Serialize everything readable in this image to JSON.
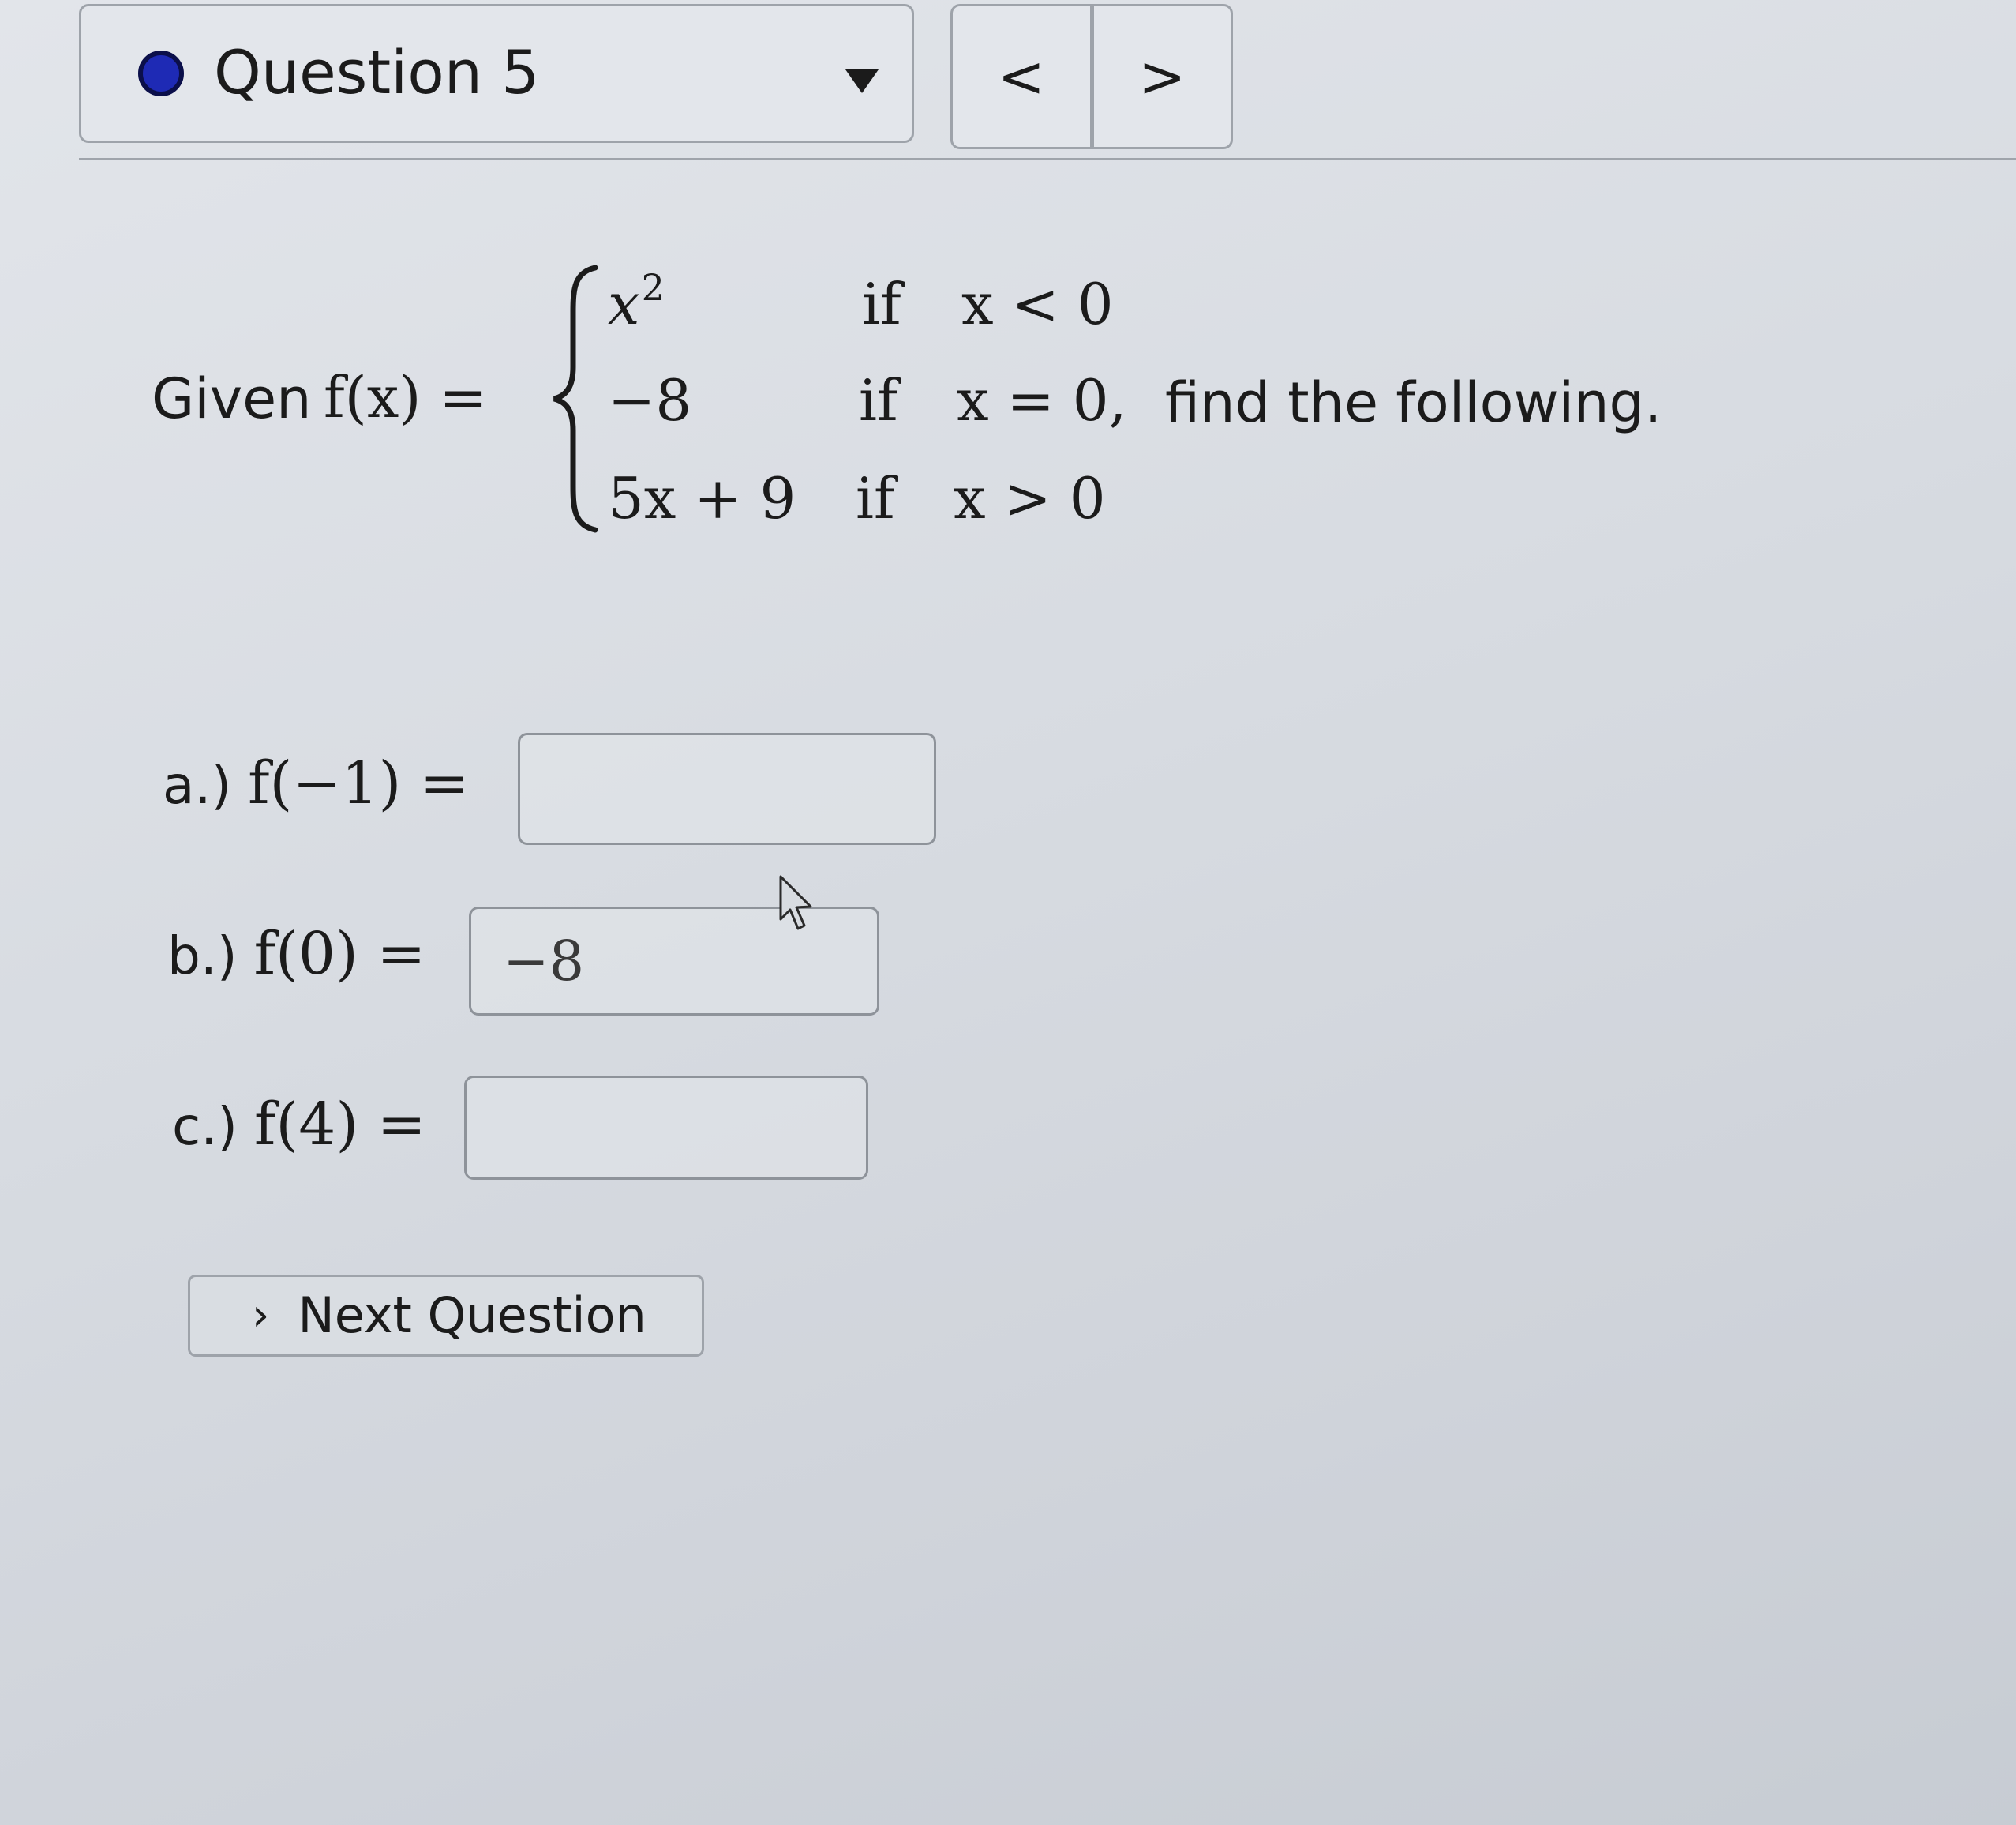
{
  "header": {
    "question_label": "Question 5",
    "status_dot_color": "#1e2ab5",
    "dropdown_icon": "caret-down-icon",
    "prev_label": "<",
    "next_label": ">"
  },
  "problem": {
    "given_text": "Given",
    "function_lhs": "f(x) =",
    "cases": [
      {
        "expr": "x",
        "expr_sup": "2",
        "if": "if",
        "cond": "x < 0"
      },
      {
        "expr": "−8",
        "expr_sup": "",
        "if": "if",
        "cond": "x = 0,"
      },
      {
        "expr": "5x + 9",
        "expr_sup": "",
        "if": "if",
        "cond": "x > 0"
      }
    ],
    "find_text": "find the following."
  },
  "answers": [
    {
      "prefix": "a.)",
      "math": "f(−1) =",
      "value": ""
    },
    {
      "prefix": "b.)",
      "math": "f(0) =",
      "value": "−8"
    },
    {
      "prefix": "c.)",
      "math": "f(4) =",
      "value": ""
    }
  ],
  "next_button": {
    "label": "Next Question",
    "icon": "chevron-right-icon"
  },
  "cursor": "mouse-pointer-icon"
}
